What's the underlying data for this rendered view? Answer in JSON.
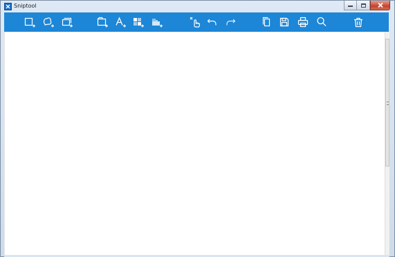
{
  "window": {
    "title": "Sniptool",
    "app_icon": "app-icon",
    "controls": [
      "minimize-icon",
      "maximize-icon",
      "close-icon"
    ]
  },
  "toolbar": {
    "background": "#1d86d6",
    "icon_color": "#ffffff",
    "buttons": [
      {
        "name": "rectangle-capture",
        "icon": "rect-snip-icon"
      },
      {
        "name": "freeform-capture",
        "icon": "freeform-snip-icon"
      },
      {
        "name": "window-capture",
        "icon": "window-snip-icon"
      },
      {
        "name": "add-frame",
        "icon": "frame-add-icon"
      },
      {
        "name": "add-text",
        "icon": "text-add-icon"
      },
      {
        "name": "add-mosaic",
        "icon": "mosaic-add-icon"
      },
      {
        "name": "add-blur",
        "icon": "blur-add-icon"
      },
      {
        "name": "clear-marks",
        "icon": "clear-pointer-icon"
      },
      {
        "name": "undo",
        "icon": "undo-icon"
      },
      {
        "name": "redo",
        "icon": "redo-icon"
      },
      {
        "name": "copy",
        "icon": "copy-icon"
      },
      {
        "name": "save",
        "icon": "save-icon"
      },
      {
        "name": "print",
        "icon": "print-icon"
      },
      {
        "name": "zoom",
        "icon": "search-icon"
      },
      {
        "name": "delete",
        "icon": "trash-icon"
      }
    ]
  }
}
